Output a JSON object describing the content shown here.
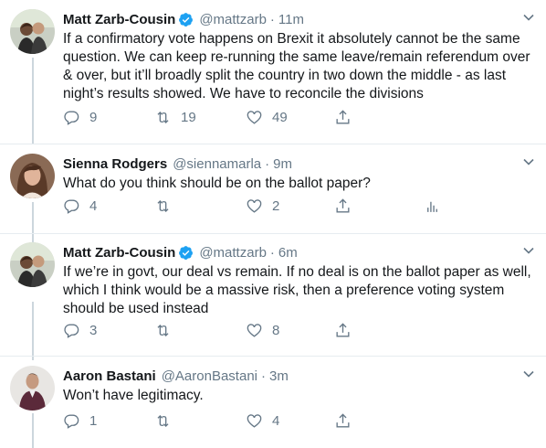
{
  "tweets": [
    {
      "name": "Matt Zarb-Cousin",
      "handle": "@mattzarb",
      "time": "11m",
      "verified": true,
      "text": "If a confirmatory vote happens on Brexit it absolutely cannot be the same question. We can keep re-running the same leave/remain referendum over & over, but it’ll broadly split the country in two down the middle - as last night’s results showed. We have to reconcile the divisions",
      "replies": "9",
      "retweets": "19",
      "likes": "49"
    },
    {
      "name": "Sienna Rodgers",
      "handle": "@siennamarla",
      "time": "9m",
      "verified": false,
      "text": "What do you think should be on the ballot paper?",
      "replies": "4",
      "retweets": "",
      "likes": "2"
    },
    {
      "name": "Matt Zarb-Cousin",
      "handle": "@mattzarb",
      "time": "6m",
      "verified": true,
      "text": "If we’re in govt, our deal vs remain. If no deal is on the ballot paper as well, which I think would be a massive risk, then a preference voting system should be used instead",
      "replies": "3",
      "retweets": "",
      "likes": "8"
    },
    {
      "name": "Aaron Bastani",
      "handle": "@AaronBastani",
      "time": "3m",
      "verified": false,
      "text": "Won’t have legitimacy.",
      "replies": "1",
      "retweets": "",
      "likes": "4"
    }
  ],
  "colors": {
    "text": "#14171a",
    "muted": "#657786",
    "verified": "#1da1f2",
    "thread_line": "#ccd6dd"
  },
  "icons": [
    "reply-icon",
    "retweet-icon",
    "like-icon",
    "share-icon",
    "analytics-icon",
    "chevron-down-icon",
    "verified-icon"
  ]
}
